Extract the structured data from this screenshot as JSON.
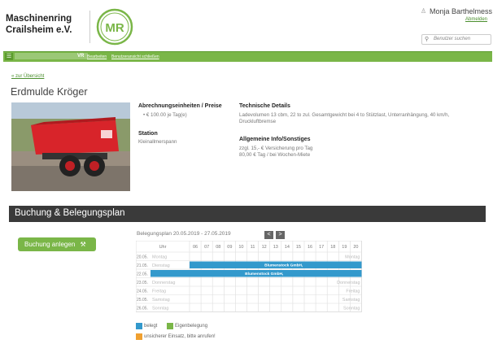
{
  "header": {
    "brand_line1": "Maschinenring",
    "brand_line2": "Crailsheim e.V.",
    "logo_text": "MR",
    "user_name": "Monja Barthelmess",
    "logout_label": "Abmelden",
    "search_placeholder": "Benutzer suchen"
  },
  "navbar": {
    "menu_icon": "menu-icon",
    "section_label": "VR",
    "edit_label": "Bearbeiten",
    "close_label": "Benutzeransicht schließen"
  },
  "page": {
    "back_link": "« zur Übersicht",
    "title": "Erdmulde Kröger"
  },
  "details": {
    "billing_heading": "Abrechnungseinheiten / Preise",
    "billing_value": "• € 100.00 je Tag(e)",
    "station_heading": "Station",
    "station_value": "Kleinallmerspann",
    "tech_heading": "Technische Details",
    "tech_line1": "Ladevolumen 13 cbm, 22 to zul. Gesamtgewicht bei 4 to Stützlast, Unterranhängung, 40 km/h,",
    "tech_line2": "Druckluftbremse",
    "info_heading": "Allgemeine Info/Sonstiges",
    "info_line1": "zzgl. 15,- € Versicherung pro Tag",
    "info_line2": "80,00 € Tag / bei Wochen-Miete"
  },
  "booking": {
    "section_title": "Buchung & Belegungsplan",
    "book_button": "Buchung anlegen",
    "plan_title": "Belegungsplan 20.05.2019 - 27.05.2019",
    "prev": "<",
    "next": ">",
    "hour_header": "Uhr",
    "hours": [
      "06",
      "07",
      "08",
      "09",
      "10",
      "11",
      "12",
      "13",
      "14",
      "15",
      "16",
      "17",
      "18",
      "19",
      "20"
    ],
    "days": [
      {
        "date": "20.05.",
        "name": "Montag"
      },
      {
        "date": "21.05.",
        "name": "Dienstag"
      },
      {
        "date": "22.05.",
        "name": "Mittwoch"
      },
      {
        "date": "23.05.",
        "name": "Donnerstag"
      },
      {
        "date": "24.05.",
        "name": "Freitag"
      },
      {
        "date": "25.05.",
        "name": "Samstag"
      },
      {
        "date": "26.05.",
        "name": "Sonntag"
      }
    ],
    "bookings": [
      {
        "label": "Blumenstock GmbH,"
      },
      {
        "label": "Blumenstock GmbH,"
      }
    ],
    "legend": [
      {
        "label": "belegt",
        "color": "#3399cc"
      },
      {
        "label": "Eigenbelegung",
        "color": "#7ab648"
      },
      {
        "label": "unsicherer Einsatz, bitte anrufen!",
        "color": "#f0a030"
      }
    ]
  }
}
